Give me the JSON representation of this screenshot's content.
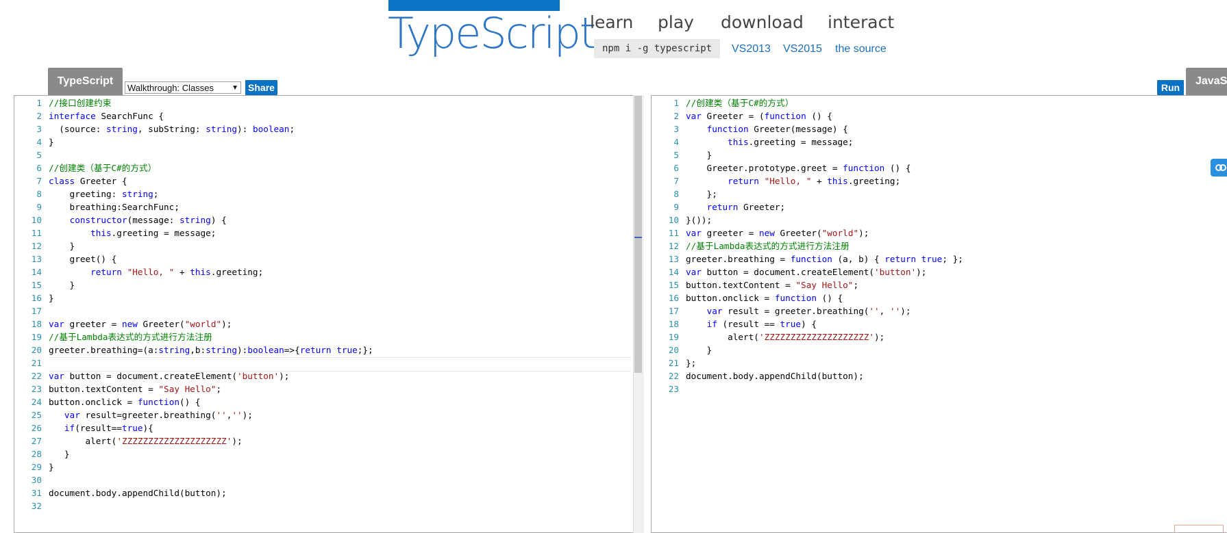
{
  "header": {
    "logo": "TypeScript",
    "nav": [
      "learn",
      "play",
      "download",
      "interact"
    ],
    "npm_command": "npm i -g typescript",
    "links": [
      "VS2013",
      "VS2015",
      "the source"
    ]
  },
  "toolbar": {
    "ts_tab": "TypeScript",
    "js_tab": "JavaScript",
    "select_value": "Walkthrough: Classes",
    "share_label": "Share",
    "run_label": "Run"
  },
  "colors": {
    "accent": "#0a72c3",
    "tab": "#8a8a8a",
    "comment": "#008000",
    "keyword": "#0000ff",
    "string": "#a31515",
    "line_number": "#2b91af"
  },
  "icons": {
    "side_widget": "link-icon",
    "select_arrow": "chevron-down-icon"
  },
  "left_editor": {
    "lines": [
      [
        [
          "cm",
          "//接口创建约束"
        ]
      ],
      [
        [
          "kw",
          "interface"
        ],
        [
          "code",
          " SearchFunc {"
        ]
      ],
      [
        [
          "code",
          "  (source: "
        ],
        [
          "kw",
          "string"
        ],
        [
          "code",
          ", subString: "
        ],
        [
          "kw",
          "string"
        ],
        [
          "code",
          "): "
        ],
        [
          "kw",
          "boolean"
        ],
        [
          "code",
          ";"
        ]
      ],
      [
        [
          "code",
          "}"
        ]
      ],
      [],
      [
        [
          "cm",
          "//创建类（基于C#的方式）"
        ]
      ],
      [
        [
          "kw",
          "class"
        ],
        [
          "code",
          " Greeter {"
        ]
      ],
      [
        [
          "code",
          "    greeting: "
        ],
        [
          "kw",
          "string"
        ],
        [
          "code",
          ";"
        ]
      ],
      [
        [
          "code",
          "    breathing:SearchFunc;"
        ]
      ],
      [
        [
          "code",
          "    "
        ],
        [
          "kw",
          "constructor"
        ],
        [
          "code",
          "(message: "
        ],
        [
          "kw",
          "string"
        ],
        [
          "code",
          ") {"
        ]
      ],
      [
        [
          "code",
          "        "
        ],
        [
          "kw",
          "this"
        ],
        [
          "code",
          ".greeting = message;"
        ]
      ],
      [
        [
          "code",
          "    }"
        ]
      ],
      [
        [
          "code",
          "    greet() {"
        ]
      ],
      [
        [
          "code",
          "        "
        ],
        [
          "kw",
          "return"
        ],
        [
          "code",
          " "
        ],
        [
          "st",
          "\"Hello, \""
        ],
        [
          "code",
          " + "
        ],
        [
          "kw",
          "this"
        ],
        [
          "code",
          ".greeting;"
        ]
      ],
      [
        [
          "code",
          "    }"
        ]
      ],
      [
        [
          "code",
          "}"
        ]
      ],
      [],
      [
        [
          "kw",
          "var"
        ],
        [
          "code",
          " greeter = "
        ],
        [
          "kw",
          "new"
        ],
        [
          "code",
          " Greeter("
        ],
        [
          "st",
          "\"world\""
        ],
        [
          "code",
          ");"
        ]
      ],
      [
        [
          "cm",
          "//基于Lambda表达式的方式进行方法注册"
        ]
      ],
      [
        [
          "code",
          "greeter.breathing=(a:"
        ],
        [
          "kw",
          "string"
        ],
        [
          "code",
          ",b:"
        ],
        [
          "kw",
          "string"
        ],
        [
          "code",
          "):"
        ],
        [
          "kw",
          "boolean"
        ],
        [
          "code",
          "=>{"
        ],
        [
          "kw",
          "return"
        ],
        [
          "code",
          " "
        ],
        [
          "kw",
          "true"
        ],
        [
          "code",
          ";};"
        ]
      ],
      [],
      [
        [
          "kw",
          "var"
        ],
        [
          "code",
          " button = document.createElement("
        ],
        [
          "st",
          "'button'"
        ],
        [
          "code",
          ");"
        ]
      ],
      [
        [
          "code",
          "button.textContent = "
        ],
        [
          "st",
          "\"Say Hello\""
        ],
        [
          "code",
          ";"
        ]
      ],
      [
        [
          "code",
          "button.onclick = "
        ],
        [
          "kw",
          "function"
        ],
        [
          "code",
          "() {"
        ]
      ],
      [
        [
          "code",
          "   "
        ],
        [
          "kw",
          "var"
        ],
        [
          "code",
          " result=greeter.breathing("
        ],
        [
          "st",
          "''"
        ],
        [
          "code",
          ","
        ],
        [
          "st",
          "''"
        ],
        [
          "code",
          ");"
        ]
      ],
      [
        [
          "code",
          "   "
        ],
        [
          "kw",
          "if"
        ],
        [
          "code",
          "(result=="
        ],
        [
          "kw",
          "true"
        ],
        [
          "code",
          "){"
        ]
      ],
      [
        [
          "code",
          "       alert("
        ],
        [
          "st",
          "'ZZZZZZZZZZZZZZZZZZZZ'"
        ],
        [
          "code",
          ");"
        ]
      ],
      [
        [
          "code",
          "   }"
        ]
      ],
      [
        [
          "code",
          "}"
        ]
      ],
      [],
      [
        [
          "code",
          "document.body.appendChild(button);"
        ]
      ],
      []
    ]
  },
  "right_editor": {
    "lines": [
      [
        [
          "cm",
          "//创建类（基于C#的方式）"
        ]
      ],
      [
        [
          "kw",
          "var"
        ],
        [
          "code",
          " Greeter = ("
        ],
        [
          "kw",
          "function"
        ],
        [
          "code",
          " () {"
        ]
      ],
      [
        [
          "code",
          "    "
        ],
        [
          "kw",
          "function"
        ],
        [
          "code",
          " Greeter(message) {"
        ]
      ],
      [
        [
          "code",
          "        "
        ],
        [
          "kw",
          "this"
        ],
        [
          "code",
          ".greeting = message;"
        ]
      ],
      [
        [
          "code",
          "    }"
        ]
      ],
      [
        [
          "code",
          "    Greeter.prototype.greet = "
        ],
        [
          "kw",
          "function"
        ],
        [
          "code",
          " () {"
        ]
      ],
      [
        [
          "code",
          "        "
        ],
        [
          "kw",
          "return"
        ],
        [
          "code",
          " "
        ],
        [
          "st",
          "\"Hello, \""
        ],
        [
          "code",
          " + "
        ],
        [
          "kw",
          "this"
        ],
        [
          "code",
          ".greeting;"
        ]
      ],
      [
        [
          "code",
          "    };"
        ]
      ],
      [
        [
          "code",
          "    "
        ],
        [
          "kw",
          "return"
        ],
        [
          "code",
          " Greeter;"
        ]
      ],
      [
        [
          "code",
          "}());"
        ]
      ],
      [
        [
          "kw",
          "var"
        ],
        [
          "code",
          " greeter = "
        ],
        [
          "kw",
          "new"
        ],
        [
          "code",
          " Greeter("
        ],
        [
          "st",
          "\"world\""
        ],
        [
          "code",
          ");"
        ]
      ],
      [
        [
          "cm",
          "//基于Lambda表达式的方式进行方法注册"
        ]
      ],
      [
        [
          "code",
          "greeter.breathing = "
        ],
        [
          "kw",
          "function"
        ],
        [
          "code",
          " (a, b) { "
        ],
        [
          "kw",
          "return"
        ],
        [
          "code",
          " "
        ],
        [
          "kw",
          "true"
        ],
        [
          "code",
          "; };"
        ]
      ],
      [
        [
          "kw",
          "var"
        ],
        [
          "code",
          " button = document.createElement("
        ],
        [
          "st",
          "'button'"
        ],
        [
          "code",
          ");"
        ]
      ],
      [
        [
          "code",
          "button.textContent = "
        ],
        [
          "st",
          "\"Say Hello\""
        ],
        [
          "code",
          ";"
        ]
      ],
      [
        [
          "code",
          "button.onclick = "
        ],
        [
          "kw",
          "function"
        ],
        [
          "code",
          " () {"
        ]
      ],
      [
        [
          "code",
          "    "
        ],
        [
          "kw",
          "var"
        ],
        [
          "code",
          " result = greeter.breathing("
        ],
        [
          "st",
          "''"
        ],
        [
          "code",
          ", "
        ],
        [
          "st",
          "''"
        ],
        [
          "code",
          ");"
        ]
      ],
      [
        [
          "code",
          "    "
        ],
        [
          "kw",
          "if"
        ],
        [
          "code",
          " (result == "
        ],
        [
          "kw",
          "true"
        ],
        [
          "code",
          ") {"
        ]
      ],
      [
        [
          "code",
          "        alert("
        ],
        [
          "st",
          "'ZZZZZZZZZZZZZZZZZZZZ'"
        ],
        [
          "code",
          ");"
        ]
      ],
      [
        [
          "code",
          "    }"
        ]
      ],
      [
        [
          "code",
          "};"
        ]
      ],
      [
        [
          "code",
          "document.body.appendChild(button);"
        ]
      ],
      []
    ]
  }
}
